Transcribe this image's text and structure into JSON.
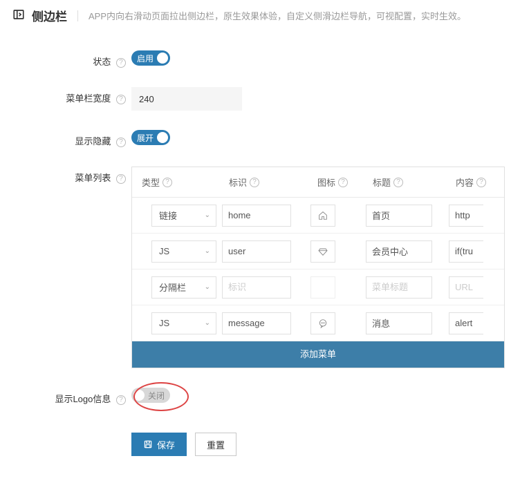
{
  "header": {
    "title": "侧边栏",
    "desc": "APP内向右滑动页面拉出侧边栏，原生效果体验，自定义侧滑边栏导航，可视配置，实时生效。"
  },
  "labels": {
    "status": "状态",
    "menuWidth": "菜单栏宽度",
    "showHide": "显示隐藏",
    "menuList": "菜单列表",
    "showLogo": "显示Logo信息"
  },
  "values": {
    "menuWidth": "240"
  },
  "toggleText": {
    "enable": "启用",
    "expand": "展开",
    "close": "关闭"
  },
  "table": {
    "headers": {
      "type": "类型",
      "id": "标识",
      "icon": "图标",
      "title": "标题",
      "content": "内容"
    },
    "placeholders": {
      "id": "标识",
      "title": "菜单标题",
      "content": "URL"
    },
    "rows": [
      {
        "type": "链接",
        "id": "home",
        "icon": "home",
        "title": "首页",
        "content": "http"
      },
      {
        "type": "JS",
        "id": "user",
        "icon": "diamond",
        "title": "会员中心",
        "content": "if(tru"
      },
      {
        "type": "分隔栏",
        "id": "",
        "icon": "",
        "title": "",
        "content": "",
        "disabled": true
      },
      {
        "type": "JS",
        "id": "message",
        "icon": "chat",
        "title": "消息",
        "content": "alert"
      }
    ],
    "addButton": "添加菜单"
  },
  "buttons": {
    "save": "保存",
    "reset": "重置"
  }
}
